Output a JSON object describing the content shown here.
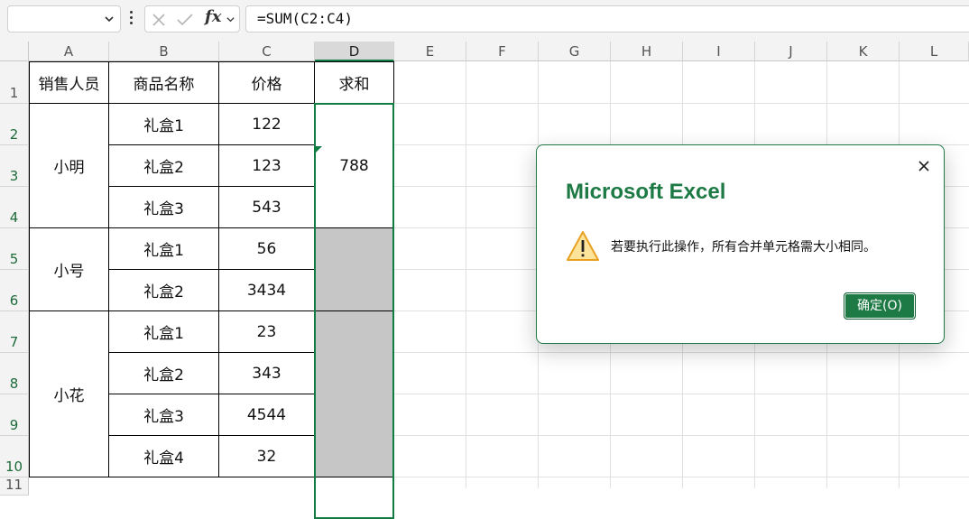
{
  "formula_bar": {
    "name_box": "",
    "fx_label": "fx",
    "formula": "=SUM(C2:C4)"
  },
  "columns": [
    "A",
    "B",
    "C",
    "D",
    "E",
    "F",
    "G",
    "H",
    "I",
    "J",
    "K",
    "L"
  ],
  "rows": [
    "1",
    "2",
    "3",
    "4",
    "5",
    "6",
    "7",
    "8",
    "9",
    "10",
    "11"
  ],
  "table": {
    "headers": [
      "销售人员",
      "商品名称",
      "价格",
      "求和"
    ],
    "salespeople": [
      "小明",
      "小号",
      "小花"
    ],
    "products": [
      "礼盒1",
      "礼盒2",
      "礼盒3",
      "礼盒1",
      "礼盒2",
      "礼盒1",
      "礼盒2",
      "礼盒3",
      "礼盒4"
    ],
    "prices": [
      "122",
      "123",
      "543",
      "56",
      "3434",
      "23",
      "343",
      "4544",
      "32"
    ],
    "sum_value": "788"
  },
  "dialog": {
    "title": "Microsoft Excel",
    "message": "若要执行此操作，所有合并单元格需大小相同。",
    "ok_label": "确定(O)"
  },
  "colors": {
    "accent": "#1e7a45",
    "selection": "#107c41",
    "grey_fill": "#c6c6c6",
    "warning": "#f0a30a"
  },
  "icons": [
    "chevron-down-icon",
    "more-options-icon",
    "cancel-icon",
    "enter-icon",
    "function-icon",
    "close-icon",
    "warning-icon"
  ]
}
